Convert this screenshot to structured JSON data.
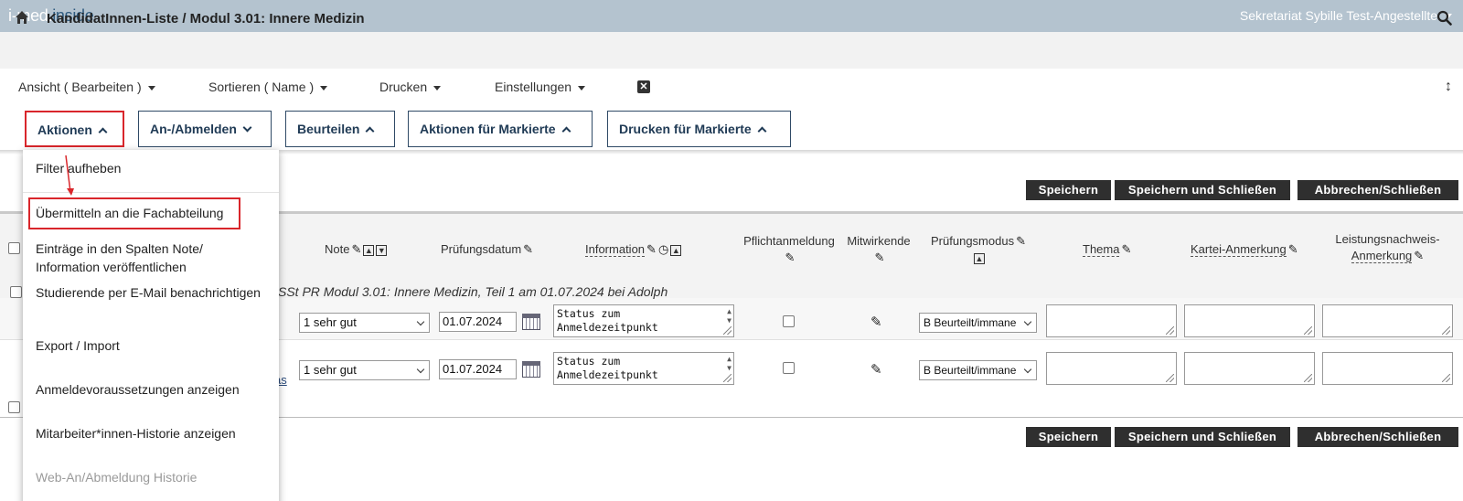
{
  "app": {
    "logo_part1": "i-med",
    "logo_dot": ".",
    "logo_part2": "inside",
    "user": "Sekretariat Sybille Test-Angestellte"
  },
  "header": {
    "title": "KandidatInnen-Liste / Modul 3.01: Innere Medizin"
  },
  "menu": {
    "ansicht": "Ansicht ( Bearbeiten )",
    "sortieren": "Sortieren ( Name )",
    "drucken": "Drucken",
    "einstellungen": "Einstellungen"
  },
  "actions": {
    "aktionen": "Aktionen",
    "anabmelden": "An-/Abmelden",
    "beurteilen": "Beurteilen",
    "aktionen_markierte": "Aktionen für Markierte",
    "drucken_markierte": "Drucken für Markierte"
  },
  "dropdown": {
    "items": [
      "Filter aufheben",
      "Übermitteln an die Fachabteilung",
      "Einträge in den Spalten Note/ Information veröffentlichen",
      "Studierende per E-Mail benachrichtigen",
      "Export / Import",
      "Anmeldevoraussetzungen anzeigen",
      "Mitarbeiter*innen-Historie anzeigen",
      "Web-An/Abmeldung Historie"
    ]
  },
  "buttons": {
    "speichern": "Speichern",
    "speichern_schliessen": "Speichern und Schließen",
    "abbrechen": "Abbrechen/Schließen"
  },
  "table": {
    "headers": {
      "note": "Note",
      "pruefungsdatum": "Prüfungsdatum",
      "information": "Information",
      "pflichtanmeldung": "Pflichtanmeldung",
      "mitwirkende": "Mitwirkende",
      "pruefungsmodus": "Prüfungsmodus",
      "thema": "Thema",
      "kartei": "Kartei-Anmerkung",
      "leistung_1": "Leistungsnachweis-",
      "leistung_2": "Anmerkung"
    },
    "group_title": "SSt PR Modul 3.01: Innere Medizin, Teil 1 am 01.07.2024 bei Adolph",
    "link_fragment": "as",
    "rows": [
      {
        "note": "1 sehr gut",
        "date": "01.07.2024",
        "info_1": "Status zum",
        "info_2": "Anmeldezeitpunkt",
        "modus": "B Beurteilt/immane"
      },
      {
        "note": "1 sehr gut",
        "date": "01.07.2024",
        "info_1": "Status zum",
        "info_2": "Anmeldezeitpunkt",
        "modus": "B Beurteilt/immane"
      }
    ]
  },
  "colors": {
    "topbar": "#b4c3cf",
    "accent_blue": "#1f3a55",
    "highlight_red": "#d9262b"
  }
}
